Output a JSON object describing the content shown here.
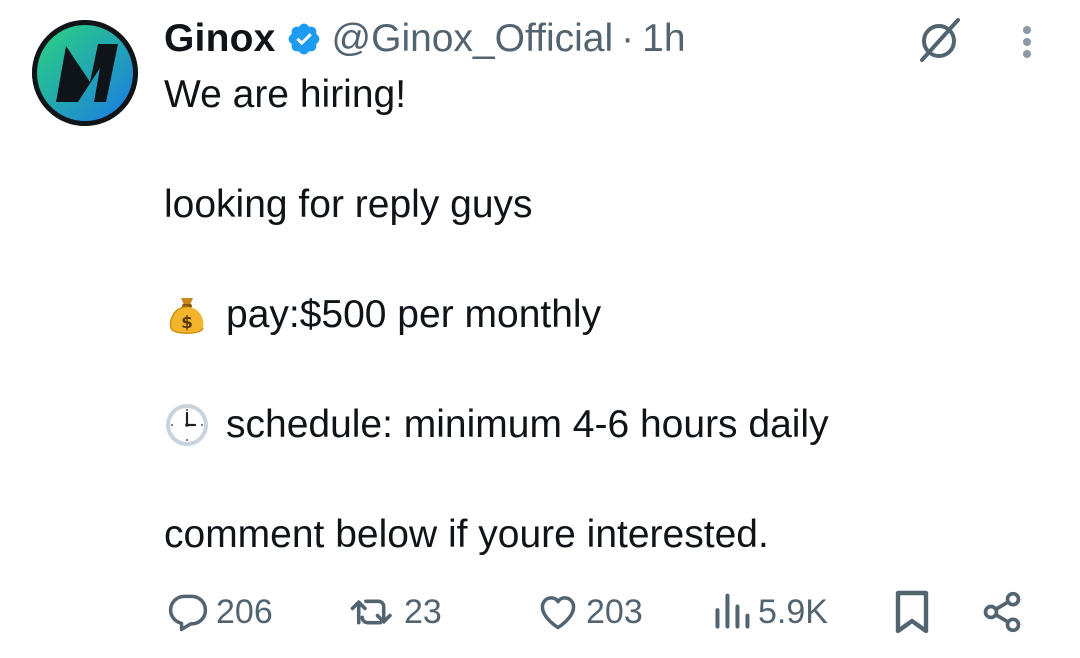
{
  "author": {
    "name": "Ginox",
    "handle": "@Ginox_Official",
    "separator": "·",
    "time": "1h",
    "verified": true,
    "avatar_icon": "ginox-logo-icon"
  },
  "tweet": {
    "lines": [
      "We are hiring!",
      "looking for reply guys",
      "pay:$500 per monthly",
      "schedule: minimum 4-6 hours daily",
      "comment below if youre interested."
    ],
    "emojis": [
      "money-bag-emoji",
      "clock-emoji"
    ]
  },
  "actions": {
    "replies": "206",
    "reposts": "23",
    "likes": "203",
    "views": "5.9K"
  },
  "icons": {
    "grok": "grok-icon",
    "more": "more-dots-icon",
    "reply": "reply-icon",
    "repost": "repost-icon",
    "like": "heart-icon",
    "views": "views-icon",
    "bookmark": "bookmark-icon",
    "share": "share-icon"
  },
  "colors": {
    "text": "#0f1419",
    "muted": "#536471",
    "verified": "#1d9bf0",
    "avatar_gradient_start": "#27d17f",
    "avatar_gradient_end": "#1d7fe0"
  }
}
